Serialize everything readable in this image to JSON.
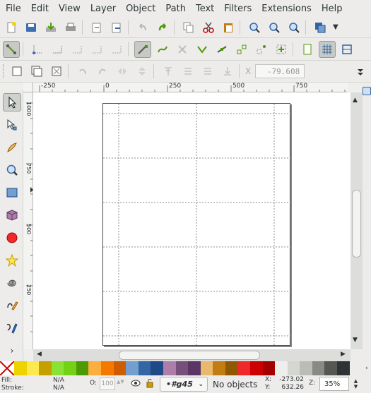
{
  "menubar": {
    "items": [
      "File",
      "Edit",
      "View",
      "Layer",
      "Object",
      "Path",
      "Text",
      "Filters",
      "Extensions",
      "Help"
    ]
  },
  "commands_toolbar": {
    "icons": [
      "new-document-icon",
      "open-icon",
      "save-icon",
      "print-icon",
      "import-icon",
      "export-icon",
      "undo-icon",
      "redo-icon",
      "duplicate-icon",
      "cut-icon",
      "paste-icon",
      "zoom-selection-icon",
      "zoom-drawing-icon",
      "zoom-page-icon",
      "document-properties-icon"
    ]
  },
  "snap_toolbar": {
    "icons": [
      "snap-toggle-icon",
      "snap-nodes-icon",
      "snap-paths-icon",
      "snap-intersections-icon",
      "snap-cusp-icon",
      "snap-smooth-icon",
      "snap-midpoints-icon",
      "snap-bbox-icon",
      "snap-grid-icon",
      "snap-guide-icon"
    ]
  },
  "tool_controls": {
    "x_label": "X",
    "x_value": "-79.608"
  },
  "rulers": {
    "horizontal": [
      "-250",
      "0",
      "250",
      "500",
      "750"
    ],
    "vertical": [
      "1000",
      "750",
      "500",
      "250"
    ]
  },
  "palette": {
    "none_label": "none",
    "colors": [
      "#edd400",
      "#fce94f",
      "#c4a000",
      "#8ae234",
      "#73d216",
      "#4e9a06",
      "#fcaf3e",
      "#f57900",
      "#ce5c00",
      "#729fcf",
      "#3465a4",
      "#204a87",
      "#ad7fa8",
      "#75507b",
      "#5c3566",
      "#e9b96e",
      "#c17d11",
      "#8f5902",
      "#ef2929",
      "#cc0000",
      "#a40000",
      "#eeeeec",
      "#d3d7cf",
      "#babdb6",
      "#888a85",
      "#555753",
      "#2e3436"
    ]
  },
  "status": {
    "fill_label": "Fill:",
    "fill_value": "N/A",
    "stroke_label": "Stroke:",
    "stroke_value": "N/A",
    "opacity_label": "O:",
    "opacity_value": "100",
    "layer_name": "•#g45",
    "message": "No objects",
    "x_label": "X:",
    "x_value": "-273.02",
    "y_label": "Y:",
    "y_value": "632.26",
    "zoom_label": "Z:",
    "zoom_value": "35%"
  }
}
